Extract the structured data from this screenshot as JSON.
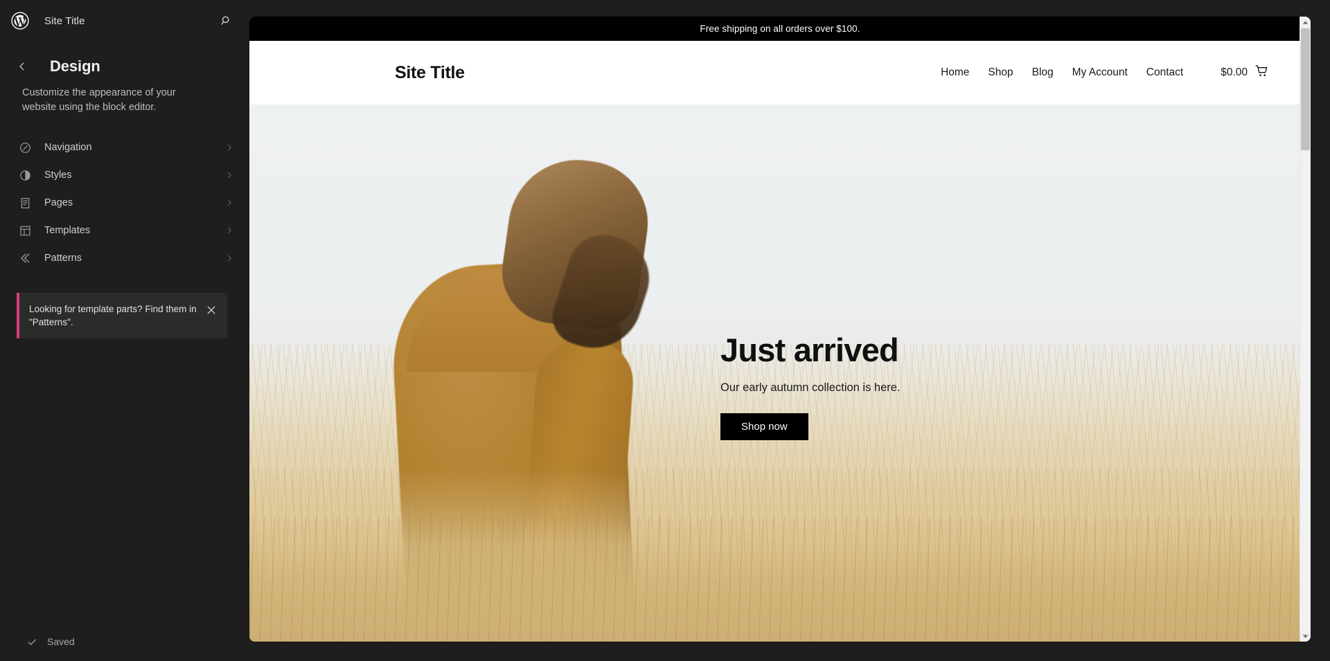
{
  "sidebar": {
    "logo_icon": "wordpress-logo-icon",
    "site_title": "Site Title",
    "search_icon": "search-icon",
    "back_icon": "chevron-left-icon",
    "heading": "Design",
    "description": "Customize the appearance of your website using the block editor.",
    "items": [
      {
        "label": "Navigation",
        "icon": "navigation-compass-icon",
        "chevron": "chevron-right-icon"
      },
      {
        "label": "Styles",
        "icon": "styles-contrast-icon",
        "chevron": "chevron-right-icon"
      },
      {
        "label": "Pages",
        "icon": "pages-document-icon",
        "chevron": "chevron-right-icon"
      },
      {
        "label": "Templates",
        "icon": "templates-layout-icon",
        "chevron": "chevron-right-icon"
      },
      {
        "label": "Patterns",
        "icon": "patterns-chevrons-icon",
        "chevron": "chevron-right-icon"
      }
    ],
    "notice": {
      "text": "Looking for template parts? Find them in \"Patterns\".",
      "close_icon": "close-icon",
      "accent_color": "#d63a7a"
    },
    "footer": {
      "check_icon": "check-icon",
      "saved_label": "Saved"
    }
  },
  "preview": {
    "announcement": "Free shipping on all orders over $100.",
    "brand": "Site Title",
    "nav": [
      {
        "label": "Home"
      },
      {
        "label": "Shop"
      },
      {
        "label": "Blog"
      },
      {
        "label": "My Account"
      },
      {
        "label": "Contact"
      }
    ],
    "cart": {
      "amount": "$0.00",
      "icon": "shopping-cart-icon"
    },
    "hero": {
      "title": "Just arrived",
      "subtitle": "Our early autumn collection is here.",
      "button": "Shop now",
      "image_alt": "person-in-camel-sweater-in-wheat-field"
    },
    "scrollbar": {
      "up_icon": "scroll-up-arrow-icon",
      "down_icon": "scroll-down-arrow-icon"
    }
  },
  "colors": {
    "sidebar_bg": "#1e1e1e",
    "notice_accent": "#d63a7a",
    "announce_bg": "#000000",
    "button_bg": "#000000"
  }
}
